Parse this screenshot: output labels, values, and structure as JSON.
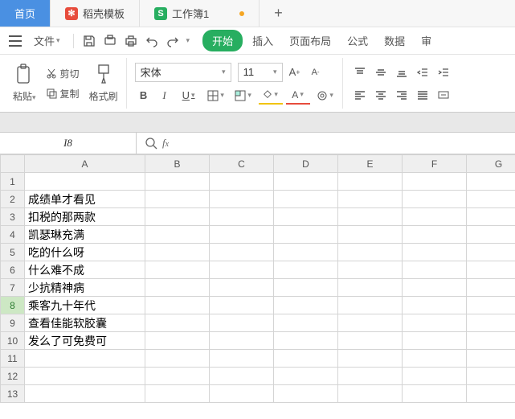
{
  "tabs": {
    "home": "首页",
    "doc1": "稻壳模板",
    "doc2": "工作簿1",
    "addTooltip": "+"
  },
  "menubar": {
    "file": "文件",
    "start": "开始",
    "insert": "插入",
    "pageLayout": "页面布局",
    "formula": "公式",
    "data": "数据",
    "review": "审"
  },
  "ribbon": {
    "paste": "粘贴",
    "cut": "剪切",
    "copy": "复制",
    "formatPainter": "格式刷",
    "fontName": "宋体",
    "fontSize": "11"
  },
  "fbar": {
    "nameBox": "I8",
    "formula": ""
  },
  "columns": [
    "A",
    "B",
    "C",
    "D",
    "E",
    "F",
    "G"
  ],
  "rowCount": 13,
  "activeRow": 8,
  "cells": {
    "A2": "成绩单才看见",
    "A3": "扣税的那两款",
    "A4": "凯瑟琳充满",
    "A5": "吃的什么呀",
    "A6": "什么难不成",
    "A7": "少抗精神病",
    "A8": "乘客九十年代",
    "A9": "查看佳能软胶囊",
    "A10": "发么了可免费可"
  }
}
